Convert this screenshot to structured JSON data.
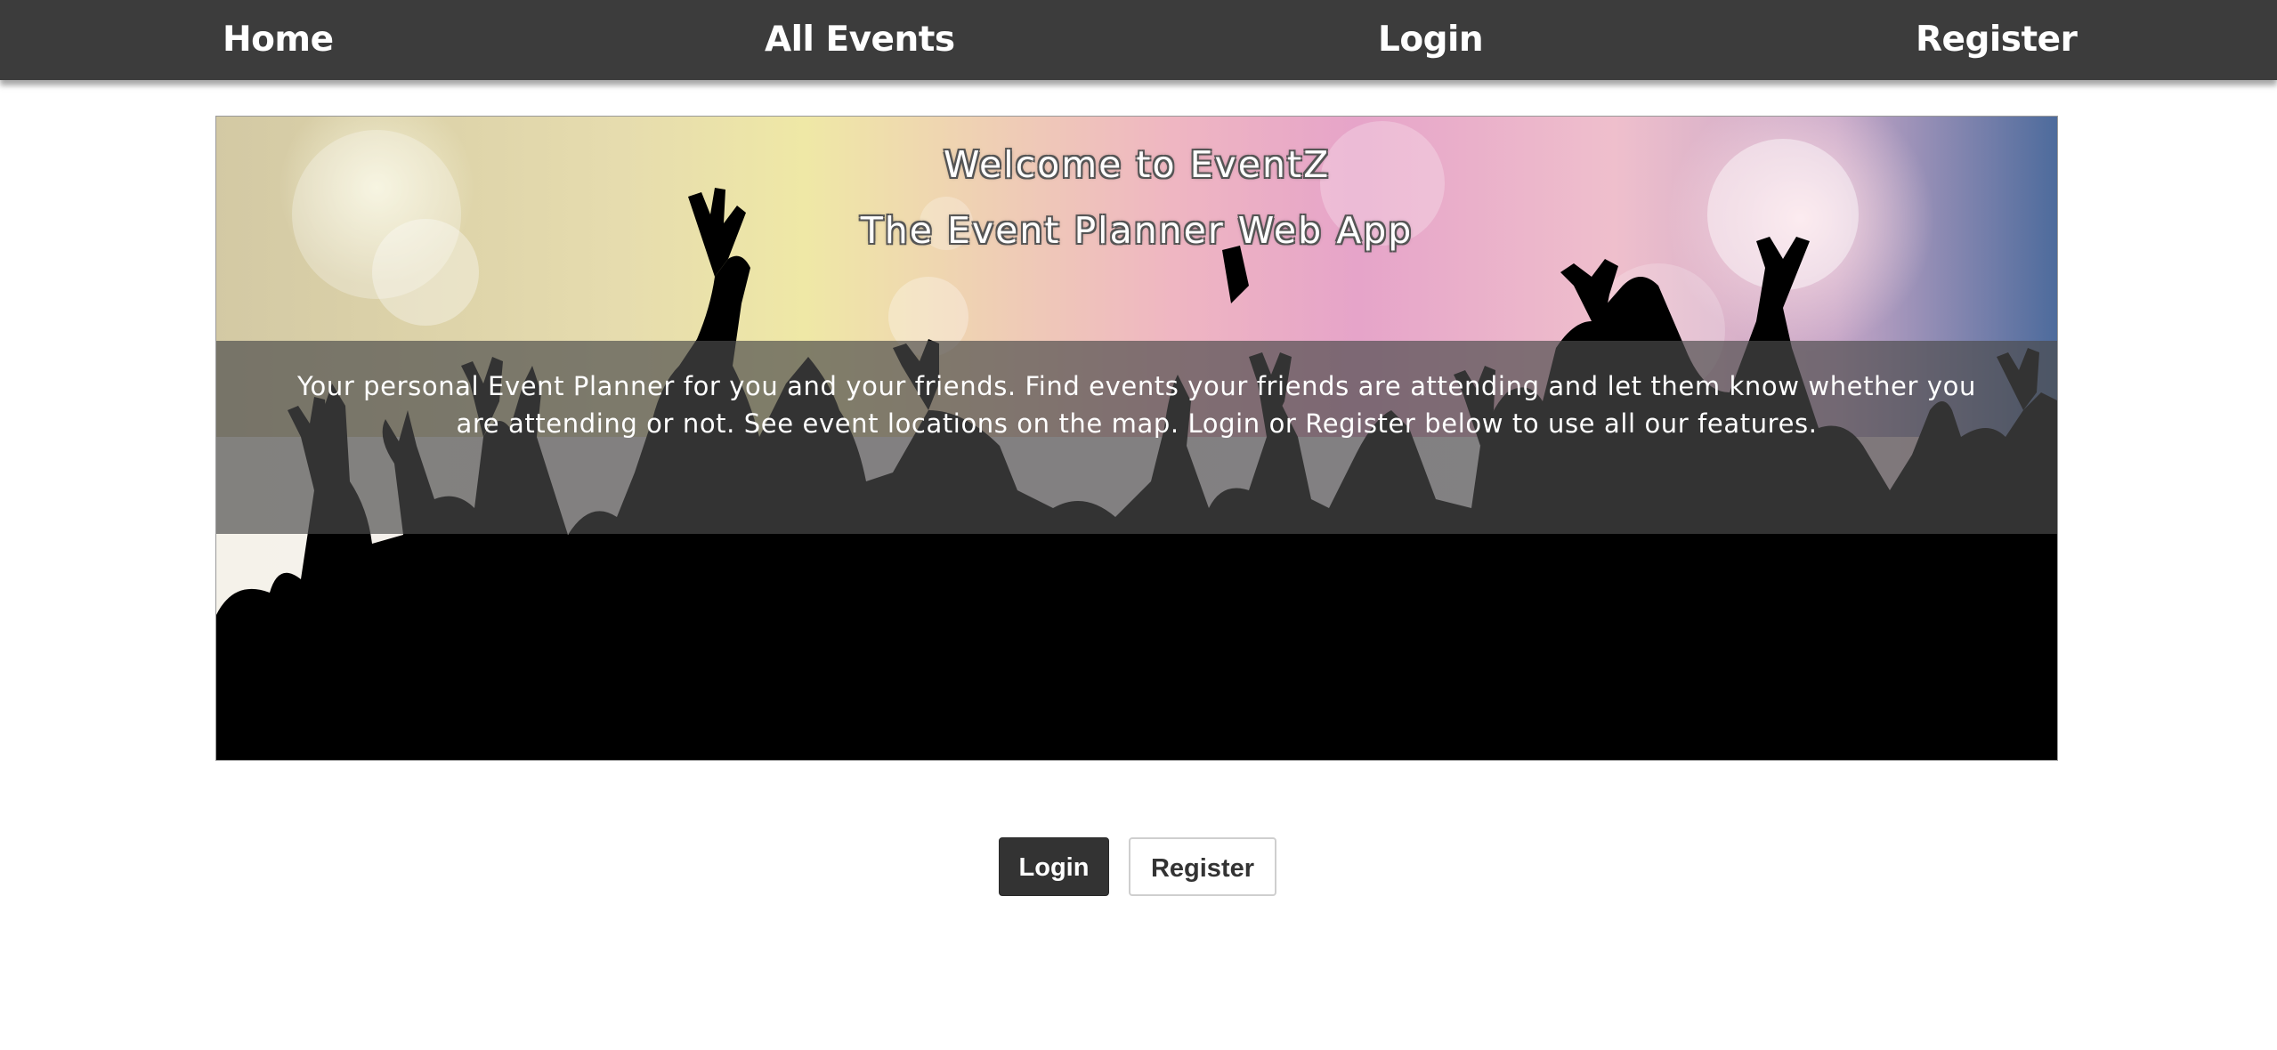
{
  "nav": {
    "items": [
      {
        "label": "Home"
      },
      {
        "label": "All Events"
      },
      {
        "label": "Login"
      },
      {
        "label": "Register"
      }
    ]
  },
  "hero": {
    "title_line1": "Welcome to EventZ",
    "title_line2": "The Event Planner Web App",
    "description": "Your personal Event Planner for you and your friends. Find events your friends are attending and let them know whether you are attending or not. See event locations on the map. Login or Register below to use all our features.",
    "image": "crowd-silhouette-concert-image"
  },
  "actions": {
    "login_label": "Login",
    "register_label": "Register"
  },
  "colors": {
    "navbar": "#3c3c3c",
    "primary_button": "#333333",
    "text_light": "#ffffff"
  }
}
